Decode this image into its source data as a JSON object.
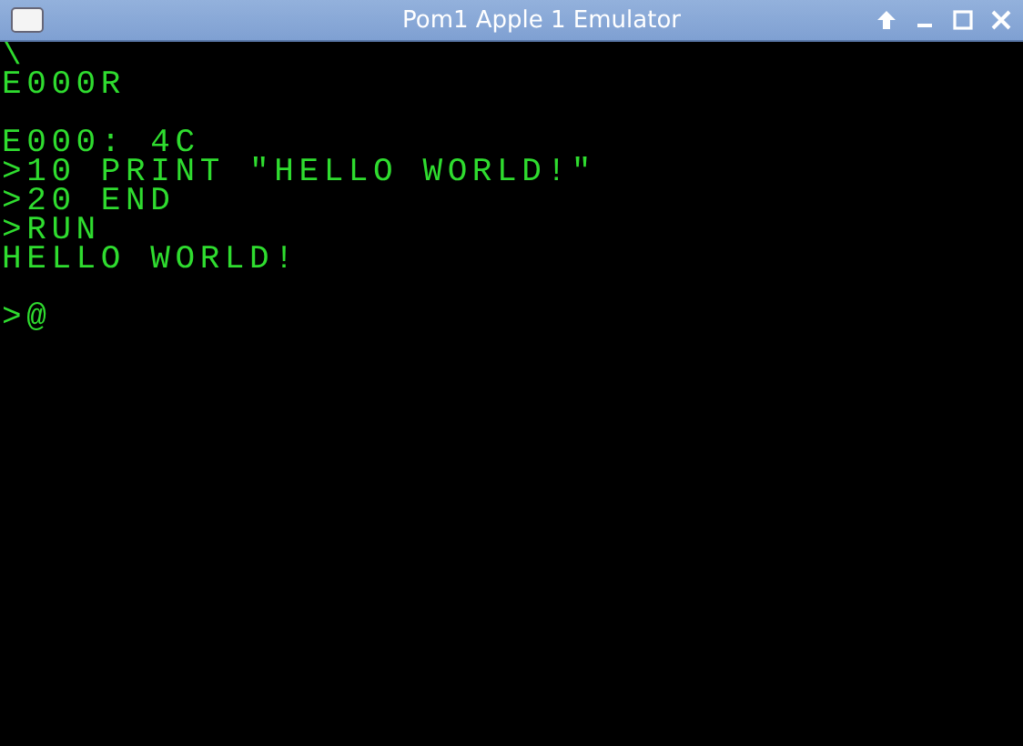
{
  "window": {
    "title": "Pom1 Apple 1 Emulator"
  },
  "terminal": {
    "lines": [
      {
        "kind": "text",
        "text": "\\"
      },
      {
        "kind": "text",
        "text": "E000R"
      },
      {
        "kind": "blank"
      },
      {
        "kind": "text",
        "text": "E000: 4C"
      },
      {
        "kind": "text",
        "text": ">10 PRINT \"HELLO WORLD!\""
      },
      {
        "kind": "text",
        "text": ">20 END"
      },
      {
        "kind": "text",
        "text": ">RUN"
      },
      {
        "kind": "text",
        "text": "HELLO WORLD!"
      },
      {
        "kind": "blank"
      },
      {
        "kind": "text",
        "text": ">@"
      }
    ]
  }
}
